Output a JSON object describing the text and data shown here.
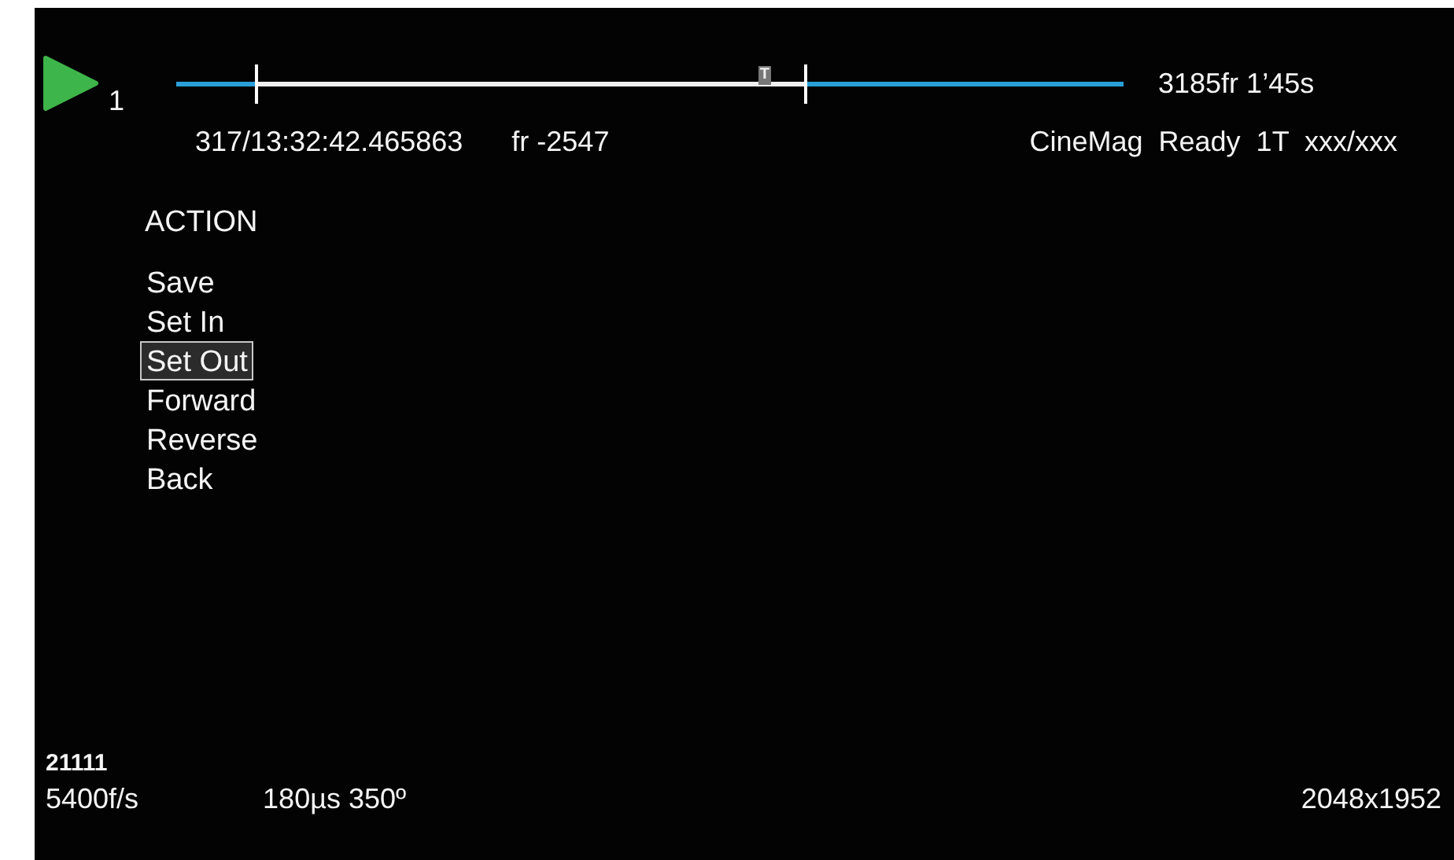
{
  "transport": {
    "clip": "1",
    "total": "3185fr 1’45s"
  },
  "timeline": {
    "markers": [
      {
        "kind": "in",
        "level": 0.085
      },
      {
        "kind": "trigger",
        "level": 0.621,
        "label": "T"
      },
      {
        "kind": "out",
        "level": 0.664
      }
    ]
  },
  "info": {
    "timecode": "317/13:32:42.465863",
    "frame": "fr -2547",
    "status": "CineMag  Ready  1T  xxx/xxx"
  },
  "menu": {
    "title": "ACTION",
    "items": [
      {
        "label": "Save",
        "selected": false
      },
      {
        "label": "Set In",
        "selected": false
      },
      {
        "label": "Set Out",
        "selected": true
      },
      {
        "label": "Forward",
        "selected": false
      },
      {
        "label": "Reverse",
        "selected": false
      },
      {
        "label": "Back",
        "selected": false
      }
    ]
  },
  "footer": {
    "id": "21111",
    "rate": "5400f/s",
    "exposure": "180µs 350º",
    "resolution": "2048x1952"
  }
}
